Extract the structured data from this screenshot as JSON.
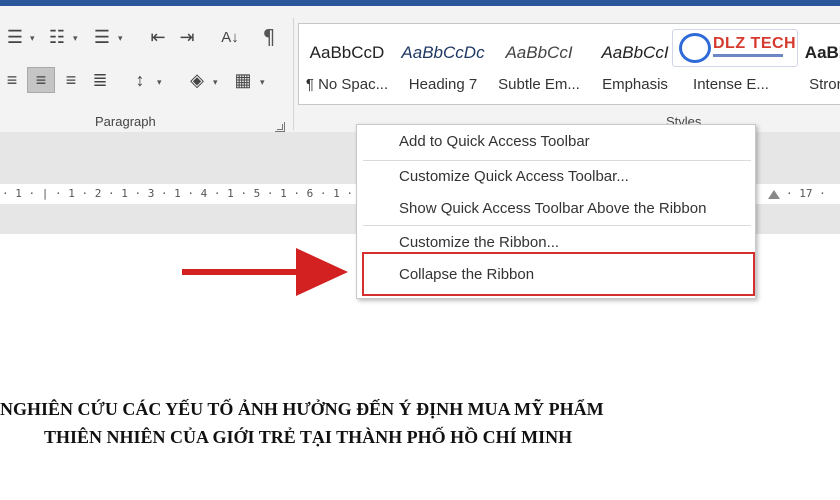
{
  "ribbon": {
    "paragraph_group_label": "Paragraph",
    "styles_group_label": "Styles",
    "pilcrow_glyph": "¶"
  },
  "styles": [
    {
      "sample": "AaBbCcD",
      "name": "¶ No Spac...",
      "italic": false
    },
    {
      "sample": "AaBbCcDc",
      "name": "Heading 7",
      "italic": true
    },
    {
      "sample": "AaBbCcI",
      "name": "Subtle Em...",
      "italic": true
    },
    {
      "sample": "AaBbCcI",
      "name": "Emphasis",
      "italic": true
    },
    {
      "sample": "",
      "name": "Intense E...",
      "italic": true
    },
    {
      "sample": "AaBb",
      "name": "Stron",
      "italic": false
    }
  ],
  "logo": {
    "text": "DLZ TECH"
  },
  "ruler": {
    "left_text": "· 1 · | · 1 · 2 · 1 · 3 · 1 · 4 · 1 · 5 · 1 · 6 · 1 ·",
    "right_text": "· 17 ·"
  },
  "context_menu": {
    "items": [
      "Add to Quick Access Toolbar",
      "Customize Quick Access Toolbar...",
      "Show Quick Access Toolbar Above the Ribbon",
      "Customize the Ribbon...",
      "Collapse the Ribbon"
    ]
  },
  "document": {
    "line1": "NGHIÊN CỨU CÁC YẾU TỐ ẢNH HƯỞNG ĐẾN Ý ĐỊNH MUA MỸ PHẨM",
    "line2": "THIÊN NHIÊN CỦA GIỚI TRẺ TẠI THÀNH PHỐ HỒ CHÍ MINH"
  },
  "colors": {
    "title_bar": "#2b579a",
    "annotation_red": "#d32121"
  }
}
